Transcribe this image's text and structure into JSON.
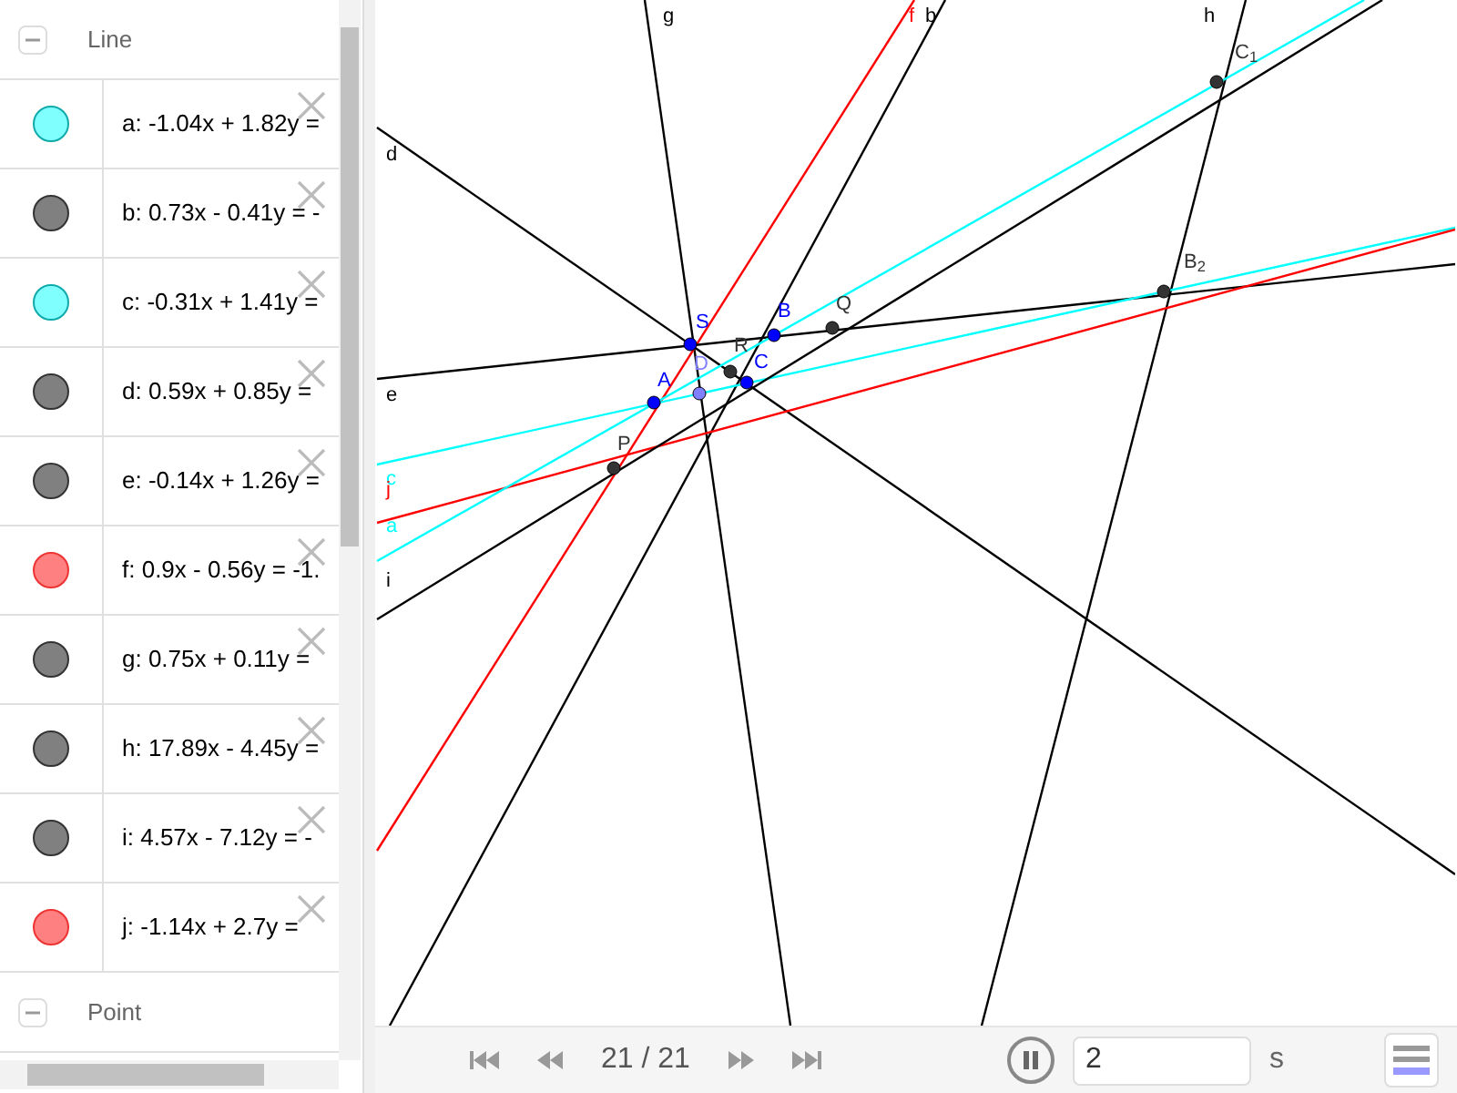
{
  "algebra": {
    "groups": [
      {
        "title": "Line",
        "expanded": true,
        "items": [
          {
            "text": "a: -1.04x + 1.82y =",
            "color": "#80ffff"
          },
          {
            "text": "b: 0.73x - 0.41y = -",
            "color": "#808080"
          },
          {
            "text": "c: -0.31x + 1.41y =",
            "color": "#80ffff"
          },
          {
            "text": "d: 0.59x + 0.85y =",
            "color": "#808080"
          },
          {
            "text": "e: -0.14x + 1.26y =",
            "color": "#808080"
          },
          {
            "text": "f: 0.9x - 0.56y = -1.",
            "color": "#ff8080"
          },
          {
            "text": "g: 0.75x + 0.11y =",
            "color": "#808080"
          },
          {
            "text": "h: 17.89x - 4.45y =",
            "color": "#808080"
          },
          {
            "text": "i: 4.57x - 7.12y = -",
            "color": "#808080"
          },
          {
            "text": "j: -1.14x + 2.7y =",
            "color": "#ff8080"
          }
        ]
      },
      {
        "title": "Point",
        "expanded": true
      }
    ]
  },
  "canvas": {
    "lines": [
      {
        "label": "g",
        "color": "#000000"
      },
      {
        "label": "f",
        "color": "#ff0000"
      },
      {
        "label": "b",
        "color": "#000000"
      },
      {
        "label": "h",
        "color": "#000000"
      },
      {
        "label": "d",
        "color": "#000000"
      },
      {
        "label": "e",
        "color": "#000000"
      },
      {
        "label": "c",
        "color": "#00ffff"
      },
      {
        "label": "j",
        "color": "#ff0000"
      },
      {
        "label": "a",
        "color": "#00ffff"
      },
      {
        "label": "i",
        "color": "#000000"
      }
    ],
    "points": [
      {
        "label": "S",
        "color": "#0000ff"
      },
      {
        "label": "B",
        "color": "#0000ff"
      },
      {
        "label": "Q",
        "color": "#333333"
      },
      {
        "label": "A",
        "color": "#0000ff"
      },
      {
        "label": "D",
        "color": "#8080ff"
      },
      {
        "label": "R",
        "color": "#333333"
      },
      {
        "label": "C",
        "color": "#0000ff"
      },
      {
        "label": "P",
        "color": "#333333"
      },
      {
        "label": "C$_{1}$",
        "color": "#333333"
      },
      {
        "label": "B$_{2}$",
        "color": "#333333"
      }
    ]
  },
  "player": {
    "counter": "21 / 21",
    "playing": true,
    "speed": "2",
    "unit": "s"
  }
}
